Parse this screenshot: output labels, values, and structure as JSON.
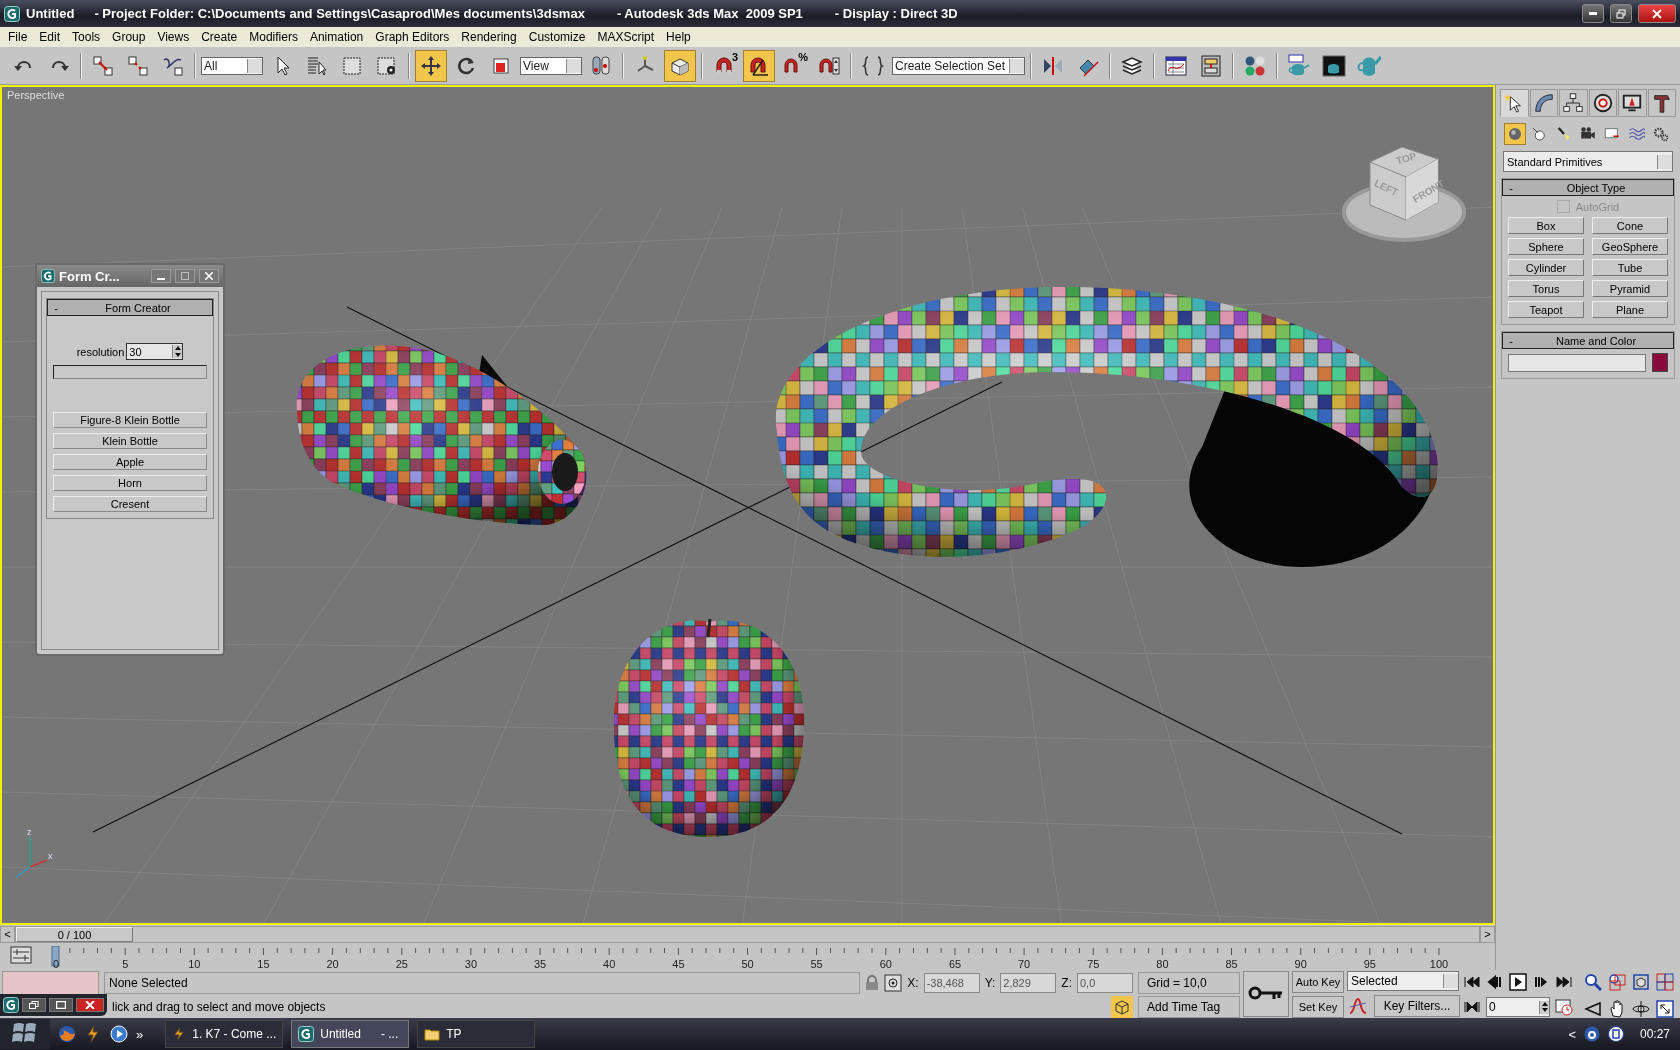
{
  "window": {
    "title": "Untitled",
    "project": "- Project Folder: C:\\Documents and Settings\\Casaprod\\Mes documents\\3dsmax",
    "app": "- Autodesk 3ds Max  2009 SP1",
    "display": "- Display : Direct 3D"
  },
  "menu": [
    "File",
    "Edit",
    "Tools",
    "Group",
    "Views",
    "Create",
    "Modifiers",
    "Animation",
    "Graph Editors",
    "Rendering",
    "Customize",
    "MAXScript",
    "Help"
  ],
  "toolbar": [
    {
      "kind": "button",
      "selected": false
    },
    {
      "kind": "button",
      "selected": false
    },
    {
      "kind": "separator"
    },
    {
      "kind": "button",
      "selected": false
    },
    {
      "kind": "button",
      "selected": false
    },
    {
      "kind": "button",
      "selected": false
    },
    {
      "kind": "separator"
    },
    {
      "kind": "dropdown",
      "value": "All"
    },
    {
      "kind": "button",
      "selected": false
    },
    {
      "kind": "button",
      "selected": false
    },
    {
      "kind": "button",
      "selected": false
    },
    {
      "kind": "button",
      "selected": false
    },
    {
      "kind": "separator"
    },
    {
      "kind": "button",
      "selected": true
    },
    {
      "kind": "button",
      "selected": false
    },
    {
      "kind": "button",
      "selected": false
    },
    {
      "kind": "dropdown",
      "value": "View"
    },
    {
      "kind": "button",
      "selected": false
    },
    {
      "kind": "separator"
    },
    {
      "kind": "button",
      "selected": false
    },
    {
      "kind": "button",
      "selected": true
    },
    {
      "kind": "separator"
    },
    {
      "kind": "button",
      "selected": false,
      "badge": "3"
    },
    {
      "kind": "button",
      "selected": true
    },
    {
      "kind": "button",
      "selected": false,
      "badge": "%"
    },
    {
      "kind": "button",
      "selected": false
    },
    {
      "kind": "separator"
    },
    {
      "kind": "button",
      "selected": false
    },
    {
      "kind": "dropdown",
      "value": "Create Selection Set"
    },
    {
      "kind": "separator"
    },
    {
      "kind": "button",
      "selected": false
    },
    {
      "kind": "button",
      "selected": false
    },
    {
      "kind": "separator"
    },
    {
      "kind": "button",
      "selected": false
    },
    {
      "kind": "separator"
    },
    {
      "kind": "button",
      "selected": false
    },
    {
      "kind": "button",
      "selected": false
    },
    {
      "kind": "separator"
    },
    {
      "kind": "button",
      "selected": false
    },
    {
      "kind": "separator"
    },
    {
      "kind": "button",
      "selected": false
    },
    {
      "kind": "button",
      "selected": false
    },
    {
      "kind": "button",
      "selected": false
    }
  ],
  "viewport": {
    "label": "Perspective",
    "active": true,
    "viewcube": {
      "top": "TOP",
      "left": "LEFT",
      "front": "FRONT"
    },
    "axes": {
      "x": "x",
      "z": "z"
    }
  },
  "form_creator": {
    "title": "Form Cr...",
    "toggle": "-",
    "rollout": "Form Creator",
    "resolution": {
      "label": "resolution",
      "value": "30"
    },
    "buttons": [
      "Figure-8 Klein Bottle",
      "Klein Bottle",
      "Apple",
      "Horn",
      "Cresent"
    ]
  },
  "command_panel": {
    "tabs": [
      {
        "selected": true
      },
      {
        "selected": false
      },
      {
        "selected": false
      },
      {
        "selected": false
      },
      {
        "selected": false
      },
      {
        "selected": false
      }
    ],
    "categories": [
      {
        "selected": true
      },
      {
        "selected": false
      },
      {
        "selected": false
      },
      {
        "selected": false
      },
      {
        "selected": false
      },
      {
        "selected": false
      },
      {
        "selected": false
      }
    ],
    "dropdown": "Standard Primitives",
    "object_type": {
      "toggle": "-",
      "title": "Object Type",
      "autogrid": {
        "label": "AutoGrid",
        "checked": false,
        "disabled": true
      },
      "buttons": [
        "Box",
        "Cone",
        "Sphere",
        "GeoSphere",
        "Cylinder",
        "Tube",
        "Torus",
        "Pyramid",
        "Teapot",
        "Plane"
      ]
    },
    "name_color": {
      "toggle": "-",
      "title": "Name and Color",
      "color": "#8a0a3c"
    }
  },
  "time_slider": {
    "label": "0 / 100",
    "prev": "<",
    "next": ">",
    "level": 0
  },
  "ruler_labels": [
    "0",
    "5",
    "10",
    "15",
    "20",
    "25",
    "30",
    "35",
    "40",
    "45",
    "50",
    "55",
    "60",
    "65",
    "70",
    "75",
    "80",
    "85",
    "90",
    "95",
    "100"
  ],
  "status": {
    "selection": "None Selected",
    "prompt": "lick and drag to select and move objects",
    "coords": [
      {
        "axis": "X:",
        "value": "-38,468"
      },
      {
        "axis": "Y:",
        "value": "2,829"
      },
      {
        "axis": "Z:",
        "value": "0,0"
      }
    ],
    "grid": "Grid = 10,0",
    "time_tag": "Add Time Tag",
    "auto_key": {
      "label": "Auto Key",
      "on": false
    },
    "set_key": "Set Key",
    "key_mode": "Selected",
    "key_filters": "Key Filters...",
    "frame": "0"
  },
  "taskbar": {
    "chevron": "»",
    "tasks": [
      {
        "label": "1. K7 - Come ...",
        "selected": false
      },
      {
        "label": "Untitled",
        "suffix": "- ...",
        "selected": true
      },
      {
        "label": "TP",
        "selected": false
      }
    ],
    "tray_toggle": "<",
    "clock": "00:27"
  }
}
